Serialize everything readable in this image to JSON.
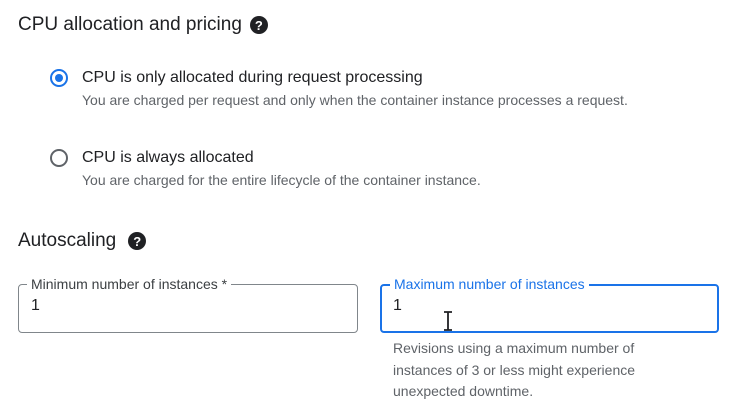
{
  "cpu": {
    "title": "CPU allocation and pricing",
    "help_icon": "help-circle-icon",
    "options": [
      {
        "label": "CPU is only allocated during request processing",
        "description": "You are charged per request and only when the container instance processes a request.",
        "selected": true
      },
      {
        "label": "CPU is always allocated",
        "description": "You are charged for the entire lifecycle of the container instance.",
        "selected": false
      }
    ]
  },
  "autoscaling": {
    "title": "Autoscaling",
    "help_icon": "help-circle-icon",
    "min_instances": {
      "label": "Minimum number of instances *",
      "value": "1"
    },
    "max_instances": {
      "label": "Maximum number of instances",
      "value": "1",
      "helper": "Revisions using a maximum number of instances of 3 or less might experience unexpected downtime."
    }
  },
  "colors": {
    "accent": "#1a73e8",
    "text": "#202124",
    "muted": "#5f6368"
  }
}
